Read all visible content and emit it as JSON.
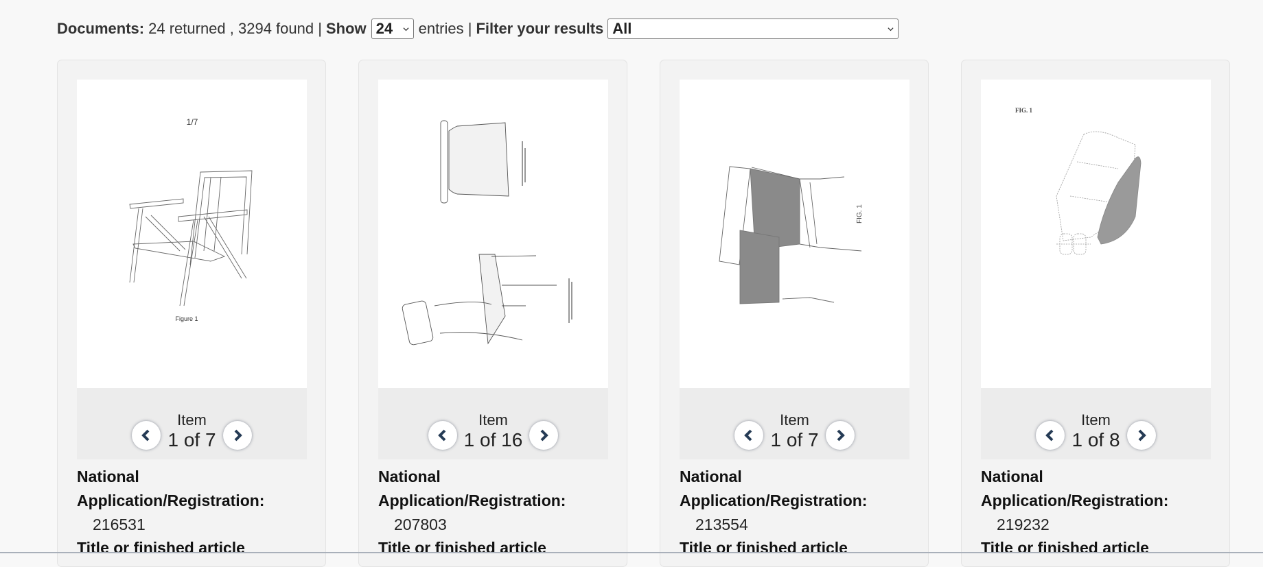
{
  "toolbar": {
    "documents_label": "Documents:",
    "returned_text": "24 returned , 3294 found |",
    "show_label": "Show",
    "show_value": "24",
    "entries_text": "entries |",
    "filter_label": "Filter your results",
    "filter_value": "All"
  },
  "cards": [
    {
      "item_label": "Item",
      "item_position": "1 of 7",
      "image_caption_top": "1/7",
      "image_caption_bottom": "Figure 1",
      "reg_label_1": "National",
      "reg_label_2": "Application/Registration:",
      "reg_value": "216531",
      "title_label": "Title or finished article"
    },
    {
      "item_label": "Item",
      "item_position": "1 of 16",
      "reg_label_1": "National",
      "reg_label_2": "Application/Registration:",
      "reg_value": "207803",
      "title_label": "Title or finished article"
    },
    {
      "item_label": "Item",
      "item_position": "1 of 7",
      "image_caption_side": "FIG. 1",
      "reg_label_1": "National",
      "reg_label_2": "Application/Registration:",
      "reg_value": "213554",
      "title_label": "Title or finished article"
    },
    {
      "item_label": "Item",
      "item_position": "1 of 8",
      "image_caption_top": "FIG. 1",
      "reg_label_1": "National",
      "reg_label_2": "Application/Registration:",
      "reg_value": "219232",
      "title_label": "Title or finished article"
    }
  ],
  "colors": {
    "nav_arrow": "#253b55",
    "page_bg": "#f8f8f8",
    "card_bg": "#f3f3f3",
    "pager_bg": "#ececec"
  }
}
